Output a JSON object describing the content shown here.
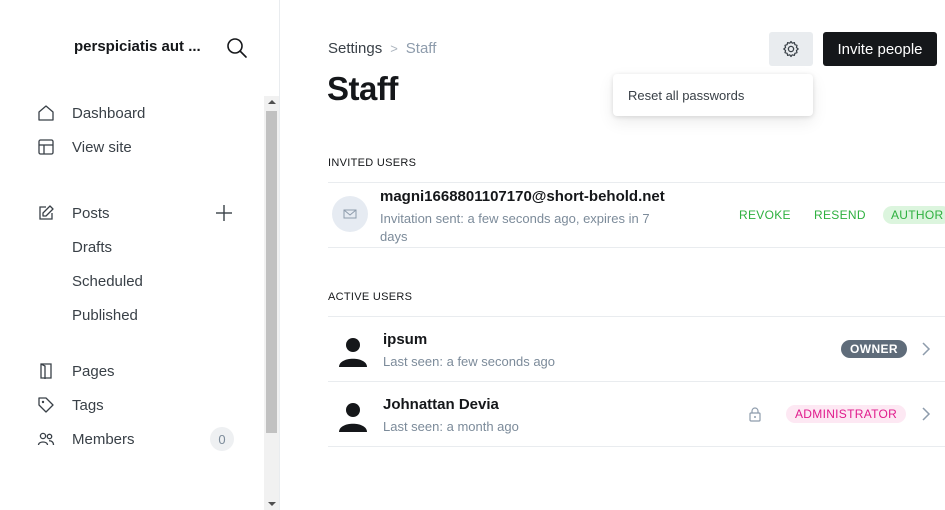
{
  "sidebar": {
    "site_title": "perspiciatis aut ...",
    "nav": {
      "dashboard": "Dashboard",
      "view_site": "View site",
      "posts": "Posts",
      "drafts": "Drafts",
      "scheduled": "Scheduled",
      "published": "Published",
      "pages": "Pages",
      "tags": "Tags",
      "members": "Members",
      "members_count": "0"
    }
  },
  "header": {
    "breadcrumb_parent": "Settings",
    "breadcrumb_separator": ">",
    "breadcrumb_current": "Staff",
    "title": "Staff",
    "invite_button": "Invite people",
    "settings_menu": {
      "items": [
        "Reset all passwords"
      ]
    }
  },
  "invited": {
    "section_label": "INVITED USERS",
    "users": [
      {
        "email": "magni1668801107170@short-behold.net",
        "meta": "Invitation sent: a few seconds ago, expires in 7 days",
        "revoke": "REVOKE",
        "resend": "RESEND",
        "role": "AUTHOR"
      }
    ]
  },
  "active": {
    "section_label": "ACTIVE USERS",
    "users": [
      {
        "name": "ipsum",
        "last_seen": "Last seen: a few seconds ago",
        "role": "OWNER"
      },
      {
        "name": "Johnattan Devia",
        "last_seen": "Last seen: a month ago",
        "role": "ADMINISTRATOR"
      }
    ]
  },
  "colors": {
    "primary": "#15171a",
    "green": "#2eb03f",
    "pink": "#e01b8c",
    "owner_badge": "#5f6c7a"
  }
}
